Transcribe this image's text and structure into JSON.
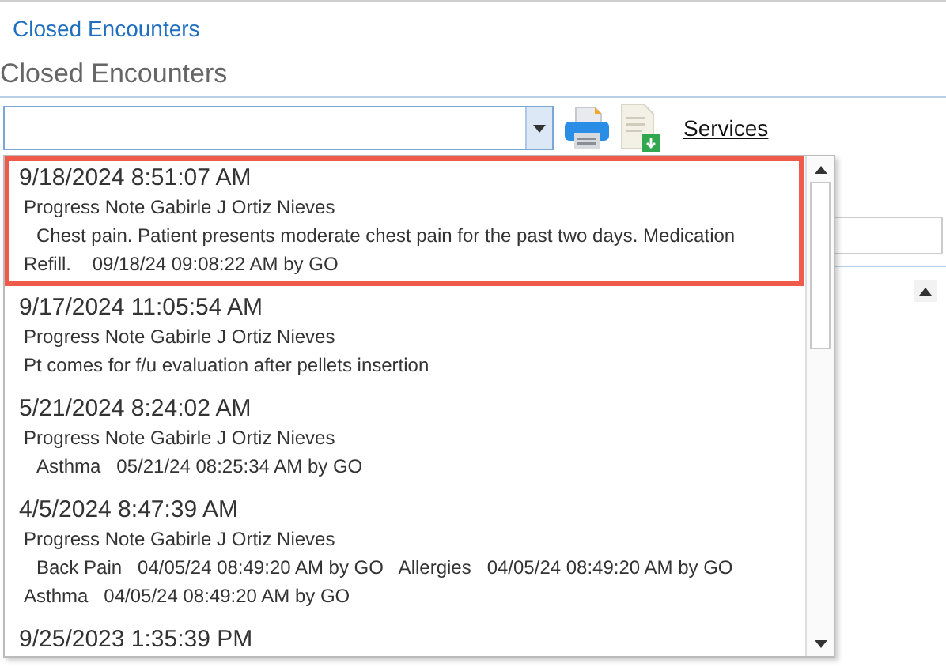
{
  "breadcrumb": "Closed Encounters",
  "heading": "Closed Encounters",
  "services_link": "Services",
  "encounters": [
    {
      "date": "9/18/2024 8:51:07 AM",
      "title": "Progress Note Gabirle J Ortiz Nieves",
      "detail": "Chest pain. Patient presents moderate chest pain for the past two days. Medication Refill.    09/18/24 09:08:22 AM by GO",
      "indent": true,
      "selected": true
    },
    {
      "date": "9/17/2024 11:05:54 AM",
      "title": "Progress Note Gabirle J Ortiz Nieves",
      "detail": "Pt comes for f/u evaluation after pellets insertion",
      "indent": false,
      "selected": false
    },
    {
      "date": "5/21/2024 8:24:02 AM",
      "title": "Progress Note Gabirle J Ortiz Nieves",
      "detail": "Asthma   05/21/24 08:25:34 AM by GO",
      "indent": true,
      "selected": false
    },
    {
      "date": "4/5/2024 8:47:39 AM",
      "title": "Progress Note Gabirle J Ortiz Nieves",
      "detail": "Back Pain   04/05/24 08:49:20 AM by GO   Allergies   04/05/24 08:49:20 AM by GO   Asthma   04/05/24 08:49:20 AM by GO",
      "indent": true,
      "selected": false
    },
    {
      "date": "9/25/2023 1:35:39 PM",
      "selected": false
    }
  ]
}
